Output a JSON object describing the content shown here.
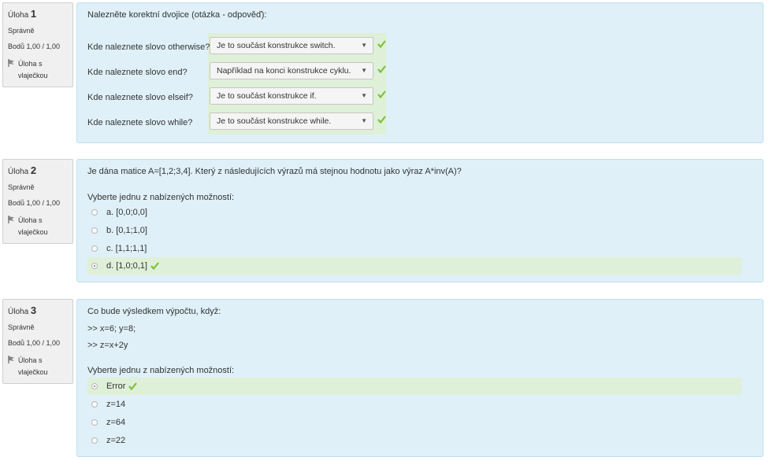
{
  "questions": [
    {
      "number_label": "Úloha",
      "number": "1",
      "state": "Správně",
      "grade": "Bodů 1,00 / 1,00",
      "flag_label": [
        "Úloha s",
        "vlaječkou"
      ],
      "text": "Nalezněte korektní dvojice (otázka - odpověď):",
      "pairs": [
        {
          "question": "Kde naleznete slovo otherwise?",
          "answer": "Je to součást konstrukce switch."
        },
        {
          "question": "Kde naleznete slovo end?",
          "answer": "Například na konci konstrukce cyklu."
        },
        {
          "question": "Kde naleznete slovo elseif?",
          "answer": "Je to součást konstrukce if."
        },
        {
          "question": "Kde naleznete slovo while?",
          "answer": "Je to součást konstrukce while."
        }
      ]
    },
    {
      "number_label": "Úloha",
      "number": "2",
      "state": "Správně",
      "grade": "Bodů 1,00 / 1,00",
      "flag_label": [
        "Úloha s",
        "vlaječkou"
      ],
      "text": "Je dána matice A=[1,2;3,4]. Který z následujících výrazů má stejnou hodnotu jako výraz A*inv(A)?",
      "prompt": "Vyberte jednu z nabízených možností:",
      "options": [
        "a. [0,0;0,0]",
        "b. [0,1;1,0]",
        "c. [1,1;1,1]",
        "d. [1,0;0,1]"
      ],
      "selected": 3
    },
    {
      "number_label": "Úloha",
      "number": "3",
      "state": "Správně",
      "grade": "Bodů 1,00 / 1,00",
      "flag_label": [
        "Úloha s",
        "vlaječkou"
      ],
      "text": "Co bude výsledkem výpočtu, když:",
      "code": [
        ">> x=6; y=8;",
        ">> z=x+2y"
      ],
      "prompt": "Vyberte jednu z nabízených možností:",
      "options": [
        "Error",
        "z=14",
        "z=64",
        "z=22"
      ],
      "selected": 0
    }
  ],
  "colors": {
    "content_bg": "#dff0f8",
    "correct_bg": "#dff0d8",
    "check_green": "#7cc13c"
  }
}
